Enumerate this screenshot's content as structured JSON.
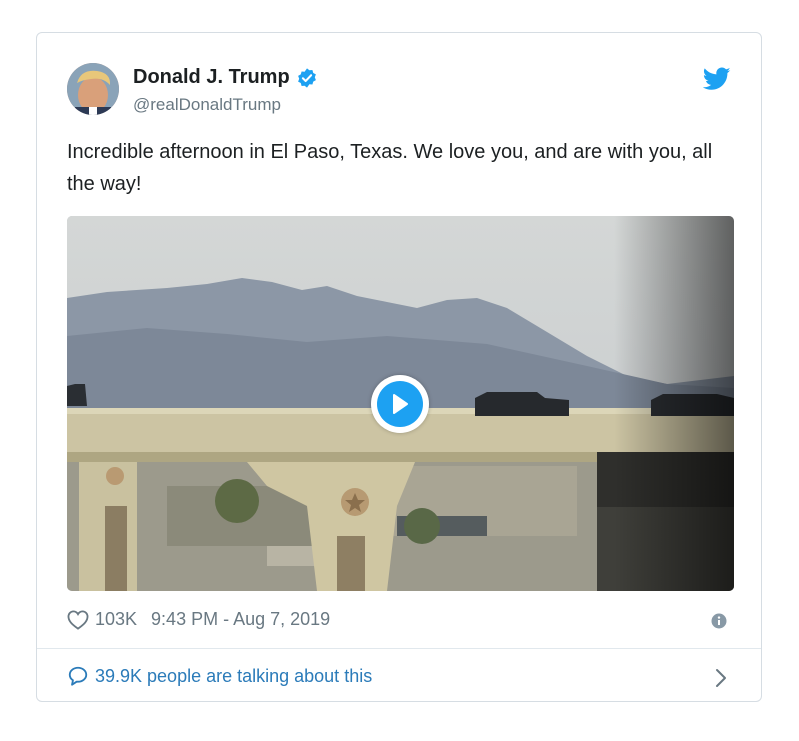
{
  "tweet": {
    "author": {
      "display_name": "Donald J. Trump",
      "handle": "@realDonaldTrump",
      "verified": true
    },
    "text": "Incredible afternoon in El Paso, Texas. We love you, and are with you, all the way!",
    "likes": "103K",
    "timestamp": "9:43 PM - Aug 7, 2019",
    "talking": "39.9K people are talking about this"
  },
  "colors": {
    "brand_blue": "#1da1f2",
    "link_blue": "#2b7bb9",
    "text_primary": "#1c2022",
    "text_secondary": "#697882",
    "border": "#d6dde3"
  },
  "icons": [
    "twitter-bird-icon",
    "verified-badge-icon",
    "play-icon",
    "heart-icon",
    "info-icon",
    "speech-bubble-icon",
    "chevron-right-icon"
  ]
}
